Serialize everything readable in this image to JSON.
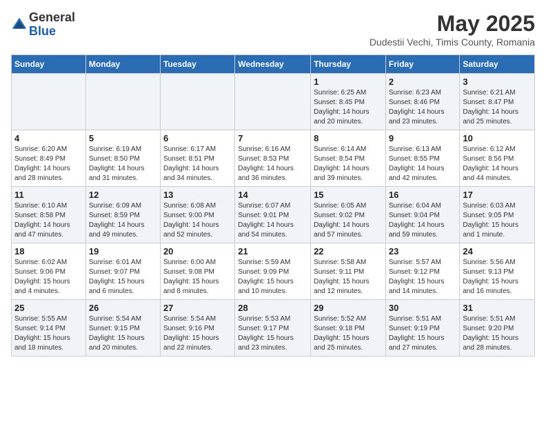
{
  "logo": {
    "general": "General",
    "blue": "Blue"
  },
  "title": "May 2025",
  "subtitle": "Dudestii Vechi, Timis County, Romania",
  "headers": [
    "Sunday",
    "Monday",
    "Tuesday",
    "Wednesday",
    "Thursday",
    "Friday",
    "Saturday"
  ],
  "weeks": [
    [
      {
        "day": "",
        "info": ""
      },
      {
        "day": "",
        "info": ""
      },
      {
        "day": "",
        "info": ""
      },
      {
        "day": "",
        "info": ""
      },
      {
        "day": "1",
        "info": "Sunrise: 6:25 AM\nSunset: 8:45 PM\nDaylight: 14 hours\nand 20 minutes."
      },
      {
        "day": "2",
        "info": "Sunrise: 6:23 AM\nSunset: 8:46 PM\nDaylight: 14 hours\nand 23 minutes."
      },
      {
        "day": "3",
        "info": "Sunrise: 6:21 AM\nSunset: 8:47 PM\nDaylight: 14 hours\nand 25 minutes."
      }
    ],
    [
      {
        "day": "4",
        "info": "Sunrise: 6:20 AM\nSunset: 8:49 PM\nDaylight: 14 hours\nand 28 minutes."
      },
      {
        "day": "5",
        "info": "Sunrise: 6:19 AM\nSunset: 8:50 PM\nDaylight: 14 hours\nand 31 minutes."
      },
      {
        "day": "6",
        "info": "Sunrise: 6:17 AM\nSunset: 8:51 PM\nDaylight: 14 hours\nand 34 minutes."
      },
      {
        "day": "7",
        "info": "Sunrise: 6:16 AM\nSunset: 8:53 PM\nDaylight: 14 hours\nand 36 minutes."
      },
      {
        "day": "8",
        "info": "Sunrise: 6:14 AM\nSunset: 8:54 PM\nDaylight: 14 hours\nand 39 minutes."
      },
      {
        "day": "9",
        "info": "Sunrise: 6:13 AM\nSunset: 8:55 PM\nDaylight: 14 hours\nand 42 minutes."
      },
      {
        "day": "10",
        "info": "Sunrise: 6:12 AM\nSunset: 8:56 PM\nDaylight: 14 hours\nand 44 minutes."
      }
    ],
    [
      {
        "day": "11",
        "info": "Sunrise: 6:10 AM\nSunset: 8:58 PM\nDaylight: 14 hours\nand 47 minutes."
      },
      {
        "day": "12",
        "info": "Sunrise: 6:09 AM\nSunset: 8:59 PM\nDaylight: 14 hours\nand 49 minutes."
      },
      {
        "day": "13",
        "info": "Sunrise: 6:08 AM\nSunset: 9:00 PM\nDaylight: 14 hours\nand 52 minutes."
      },
      {
        "day": "14",
        "info": "Sunrise: 6:07 AM\nSunset: 9:01 PM\nDaylight: 14 hours\nand 54 minutes."
      },
      {
        "day": "15",
        "info": "Sunrise: 6:05 AM\nSunset: 9:02 PM\nDaylight: 14 hours\nand 57 minutes."
      },
      {
        "day": "16",
        "info": "Sunrise: 6:04 AM\nSunset: 9:04 PM\nDaylight: 14 hours\nand 59 minutes."
      },
      {
        "day": "17",
        "info": "Sunrise: 6:03 AM\nSunset: 9:05 PM\nDaylight: 15 hours\nand 1 minute."
      }
    ],
    [
      {
        "day": "18",
        "info": "Sunrise: 6:02 AM\nSunset: 9:06 PM\nDaylight: 15 hours\nand 4 minutes."
      },
      {
        "day": "19",
        "info": "Sunrise: 6:01 AM\nSunset: 9:07 PM\nDaylight: 15 hours\nand 6 minutes."
      },
      {
        "day": "20",
        "info": "Sunrise: 6:00 AM\nSunset: 9:08 PM\nDaylight: 15 hours\nand 8 minutes."
      },
      {
        "day": "21",
        "info": "Sunrise: 5:59 AM\nSunset: 9:09 PM\nDaylight: 15 hours\nand 10 minutes."
      },
      {
        "day": "22",
        "info": "Sunrise: 5:58 AM\nSunset: 9:11 PM\nDaylight: 15 hours\nand 12 minutes."
      },
      {
        "day": "23",
        "info": "Sunrise: 5:57 AM\nSunset: 9:12 PM\nDaylight: 15 hours\nand 14 minutes."
      },
      {
        "day": "24",
        "info": "Sunrise: 5:56 AM\nSunset: 9:13 PM\nDaylight: 15 hours\nand 16 minutes."
      }
    ],
    [
      {
        "day": "25",
        "info": "Sunrise: 5:55 AM\nSunset: 9:14 PM\nDaylight: 15 hours\nand 18 minutes."
      },
      {
        "day": "26",
        "info": "Sunrise: 5:54 AM\nSunset: 9:15 PM\nDaylight: 15 hours\nand 20 minutes."
      },
      {
        "day": "27",
        "info": "Sunrise: 5:54 AM\nSunset: 9:16 PM\nDaylight: 15 hours\nand 22 minutes."
      },
      {
        "day": "28",
        "info": "Sunrise: 5:53 AM\nSunset: 9:17 PM\nDaylight: 15 hours\nand 23 minutes."
      },
      {
        "day": "29",
        "info": "Sunrise: 5:52 AM\nSunset: 9:18 PM\nDaylight: 15 hours\nand 25 minutes."
      },
      {
        "day": "30",
        "info": "Sunrise: 5:51 AM\nSunset: 9:19 PM\nDaylight: 15 hours\nand 27 minutes."
      },
      {
        "day": "31",
        "info": "Sunrise: 5:51 AM\nSunset: 9:20 PM\nDaylight: 15 hours\nand 28 minutes."
      }
    ]
  ]
}
